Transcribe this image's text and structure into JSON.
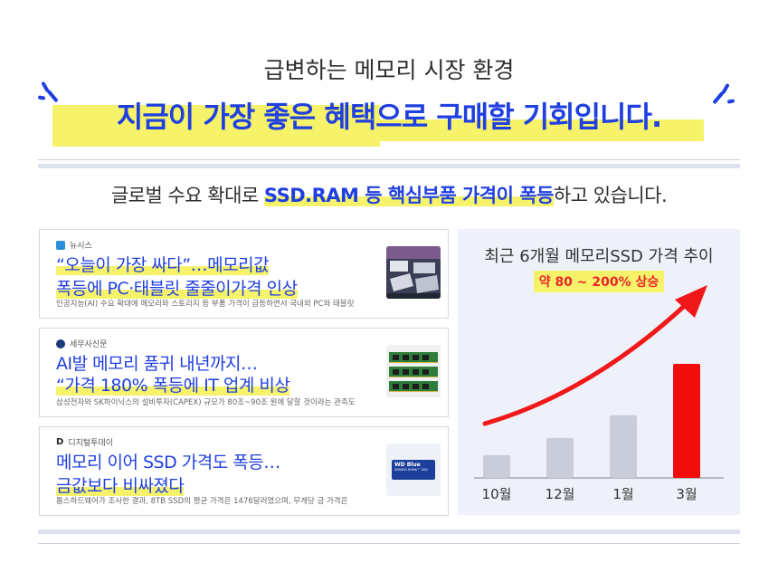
{
  "header": {
    "subtitle": "급변하는 메모리 시장 환경",
    "headline": "지금이 가장 좋은 혜택으로 구매할 기회입니다."
  },
  "description": {
    "before": "글로벌 수요 확대로 ",
    "highlight": "SSD.RAM 등 핵심부품 가격이 폭등",
    "after": "하고 있습니다."
  },
  "news": [
    {
      "source": "뉴시스",
      "line1": "“오늘이 가장 싸다”…메모리값",
      "line2": "폭등에 PC·태블릿 줄줄이가격 인상",
      "summary": "인공지능(AI) 수요 확대에 메모리와 스토리지 등 부품 가격이 급등하면서 국내외 PC와 태블릿",
      "logo_color": "#2a8fd8"
    },
    {
      "source": "세무사신문",
      "line1": "AI발 메모리 품귀 내년까지…",
      "line2": "“가격 180% 폭등에 IT 업계 비상",
      "summary": "삼성전자와 SK하이닉스의 설비투자(CAPEX) 규모가 80조~90조 원에 달할 것이라는 관측도",
      "logo_color": "#1a3a7a"
    },
    {
      "source": "디지털투데이",
      "line1": "메모리 이어 SSD 가격도 폭등…",
      "line2": "금값보다 비싸졌다",
      "summary": "톰스하드웨어가 조사한 결과, 8TB SSD의 평균 가격은 1476달러였으며, 무게당 금 가격은",
      "logo_color": "#222222",
      "logo_letter": "D",
      "thumb_brand": "WD Blue",
      "thumb_model": "SN5000 NVMe™ SSD"
    }
  ],
  "chart_data": {
    "type": "bar",
    "title": "최근 6개월 메모리SSD 가격 추이",
    "badge": "약 80 ~ 200% 상승",
    "categories": [
      "10월",
      "12월",
      "1월",
      "3월"
    ],
    "values": [
      20,
      35,
      55,
      100
    ],
    "colors": [
      "#c8cdd9",
      "#c8cdd9",
      "#c8cdd9",
      "#f20d0d"
    ],
    "trend_arrow_color": "#f01818"
  }
}
